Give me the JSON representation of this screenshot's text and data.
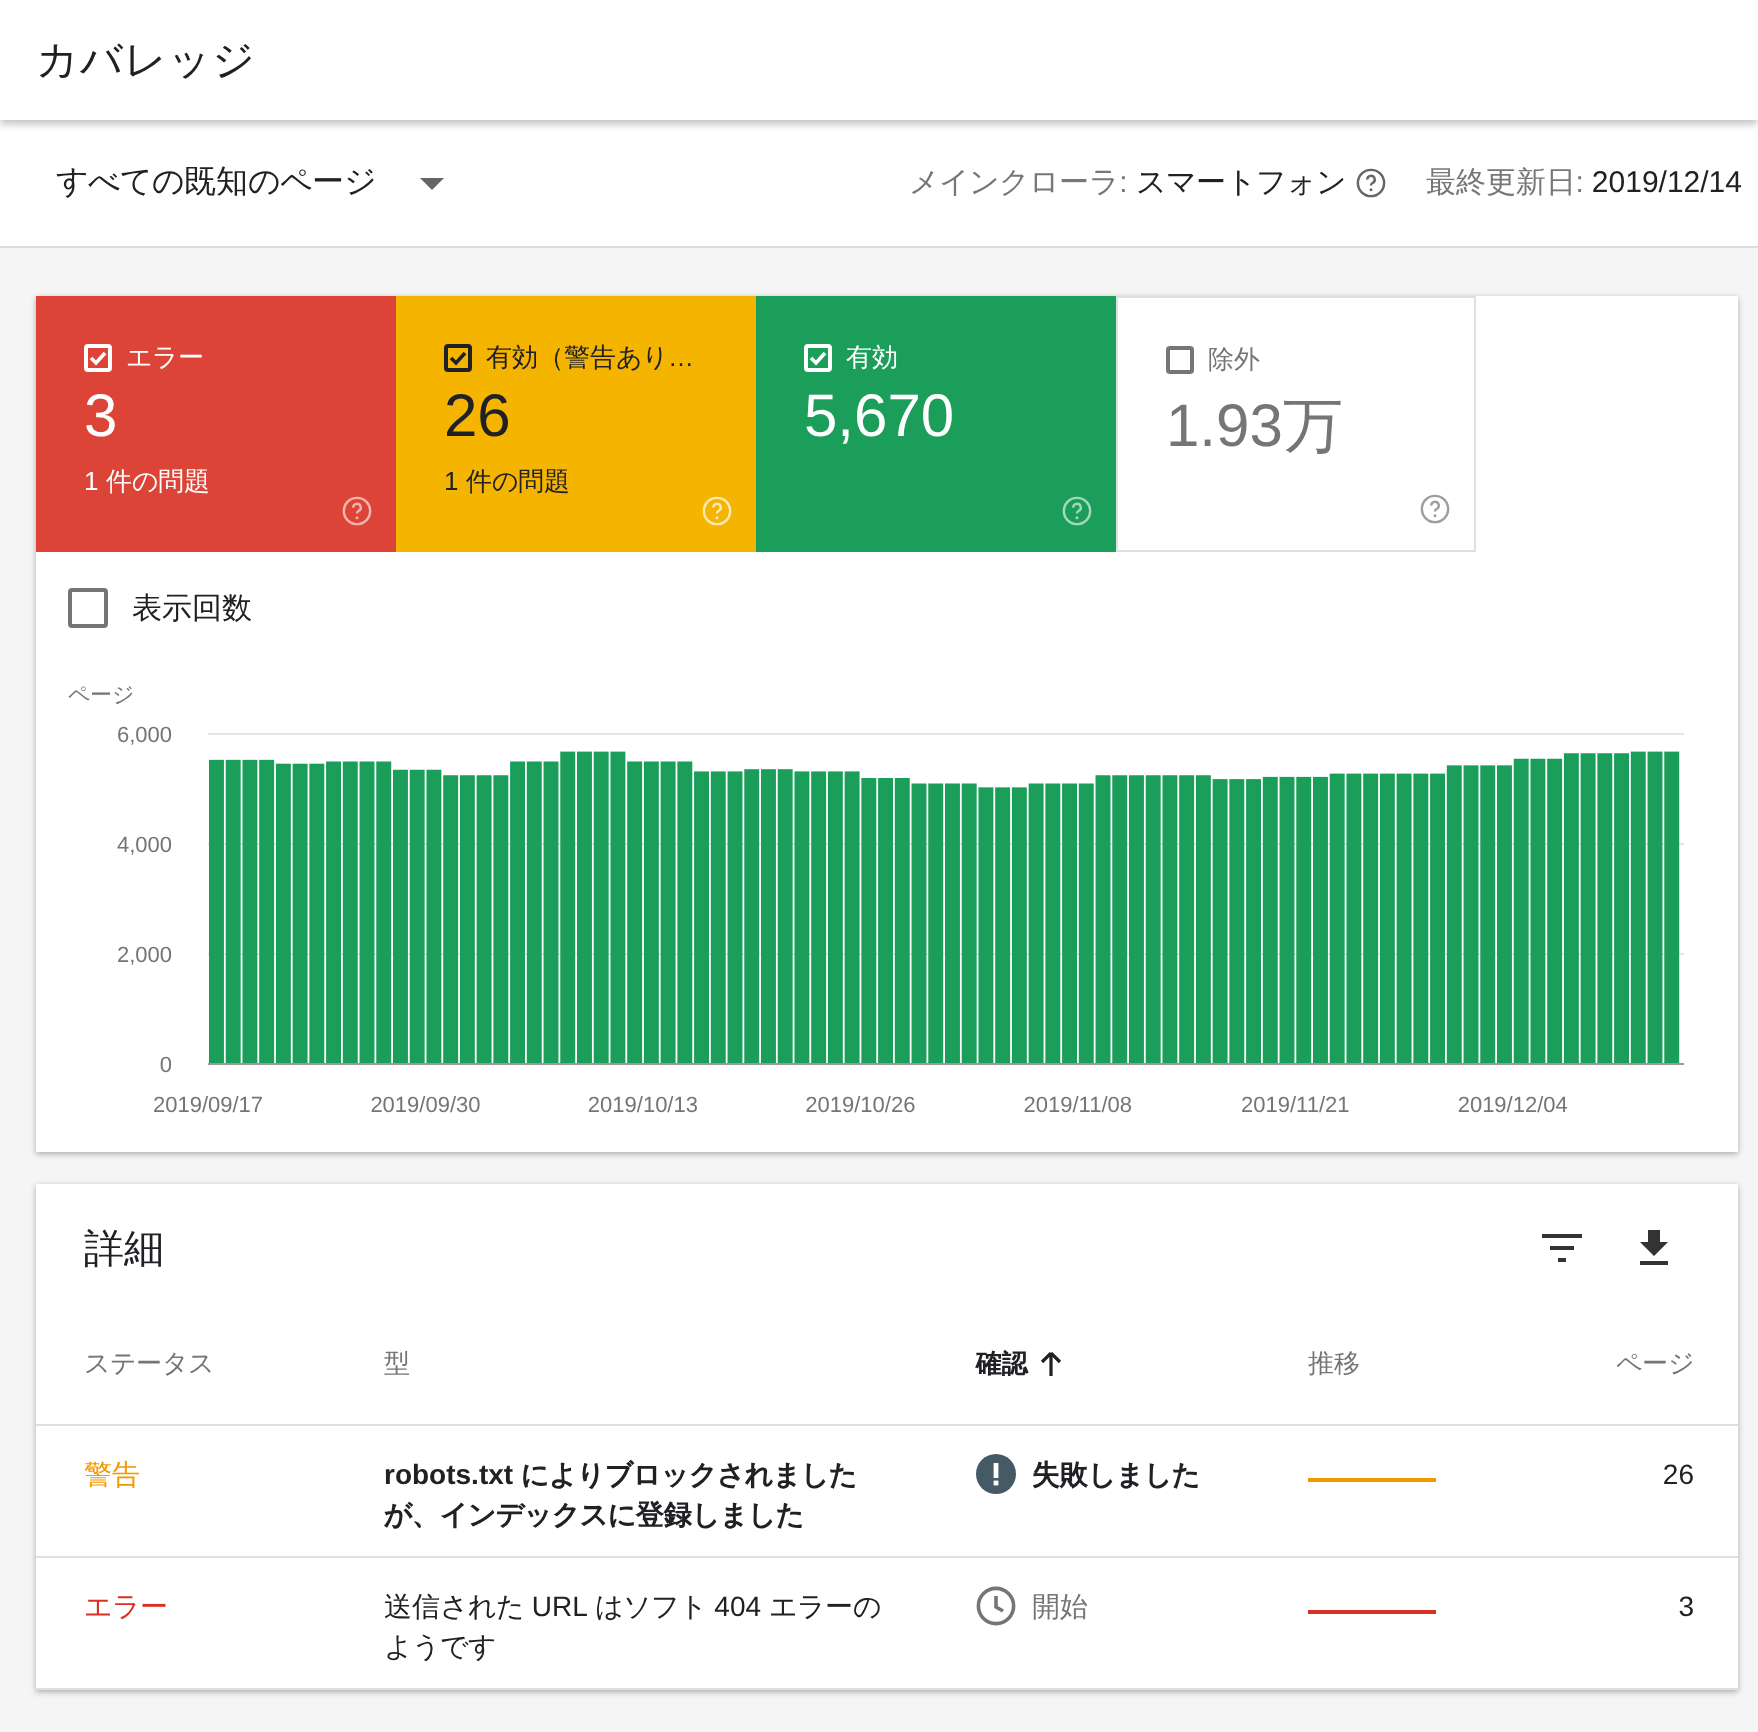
{
  "header": {
    "title": "カバレッジ"
  },
  "filter_bar": {
    "dropdown": "すべての既知のページ",
    "crawler_label": "メインクローラ:",
    "crawler_value": "スマートフォン",
    "updated_label": "最終更新日:",
    "updated_value": "2019/12/14"
  },
  "tiles": [
    {
      "kind": "error",
      "label": "エラー",
      "value": "3",
      "issues": "1 件の問題",
      "checked": true
    },
    {
      "kind": "warning",
      "label": "有効（警告あり…",
      "value": "26",
      "issues": "1 件の問題",
      "checked": true
    },
    {
      "kind": "valid",
      "label": "有効",
      "value": "5,670",
      "checked": true
    },
    {
      "kind": "excluded",
      "label": "除外",
      "value": "1.93万",
      "checked": false
    }
  ],
  "impressions": {
    "label": "表示回数",
    "checked": false
  },
  "chart_data": {
    "type": "bar",
    "ylabel": "ページ",
    "ylim": [
      0,
      6000
    ],
    "yticks": [
      {
        "value": 0,
        "label": "0"
      },
      {
        "value": 2000,
        "label": "2,000"
      },
      {
        "value": 4000,
        "label": "4,000"
      },
      {
        "value": 6000,
        "label": "6,000"
      }
    ],
    "categories": [
      "2019/09/17",
      null,
      null,
      null,
      null,
      null,
      null,
      null,
      null,
      null,
      null,
      null,
      null,
      "2019/09/30",
      null,
      null,
      null,
      null,
      null,
      null,
      null,
      null,
      null,
      null,
      null,
      null,
      "2019/10/13",
      null,
      null,
      null,
      null,
      null,
      null,
      null,
      null,
      null,
      null,
      null,
      null,
      "2019/10/26",
      null,
      null,
      null,
      null,
      null,
      null,
      null,
      null,
      null,
      null,
      null,
      null,
      "2019/11/08",
      null,
      null,
      null,
      null,
      null,
      null,
      null,
      null,
      null,
      null,
      null,
      null,
      "2019/11/21",
      null,
      null,
      null,
      null,
      null,
      null,
      null,
      null,
      null,
      null,
      null,
      null,
      "2019/12/04",
      null,
      null,
      null,
      null,
      null,
      null,
      null,
      null,
      null
    ],
    "series": [
      {
        "color": "#1a9e5a",
        "values": [
          5530,
          5530,
          5530,
          5530,
          5460,
          5460,
          5460,
          5500,
          5500,
          5500,
          5500,
          5350,
          5350,
          5350,
          5250,
          5250,
          5250,
          5250,
          5500,
          5500,
          5500,
          5680,
          5680,
          5680,
          5680,
          5500,
          5500,
          5500,
          5500,
          5320,
          5320,
          5320,
          5360,
          5360,
          5360,
          5320,
          5320,
          5320,
          5320,
          5200,
          5200,
          5200,
          5100,
          5100,
          5100,
          5100,
          5030,
          5030,
          5030,
          5100,
          5100,
          5100,
          5100,
          5250,
          5250,
          5250,
          5250,
          5250,
          5250,
          5250,
          5180,
          5180,
          5180,
          5220,
          5220,
          5220,
          5220,
          5280,
          5280,
          5280,
          5280,
          5280,
          5280,
          5280,
          5430,
          5430,
          5430,
          5430,
          5550,
          5550,
          5550,
          5650,
          5650,
          5650,
          5650,
          5680,
          5680,
          5680
        ]
      }
    ]
  },
  "details": {
    "title": "詳細",
    "columns": [
      {
        "label": "ステータス",
        "sorted": false
      },
      {
        "label": "型",
        "sorted": false
      },
      {
        "label": "確認",
        "sorted": true
      },
      {
        "label": "推移",
        "sorted": false
      },
      {
        "label": "ページ",
        "sorted": false
      }
    ],
    "rows": [
      {
        "status": "警告",
        "color": "#f29900",
        "type": "robots.txt によりブロックされましたが、インデックスに登録しました",
        "bold": true,
        "validation": "失敗しました",
        "kind": "failed",
        "pages": "26"
      },
      {
        "status": "エラー",
        "color": "#d93025",
        "type": "送信された URL はソフト 404 エラーのようです",
        "bold": false,
        "validation": "開始",
        "kind": "started",
        "pages": "3"
      }
    ]
  }
}
